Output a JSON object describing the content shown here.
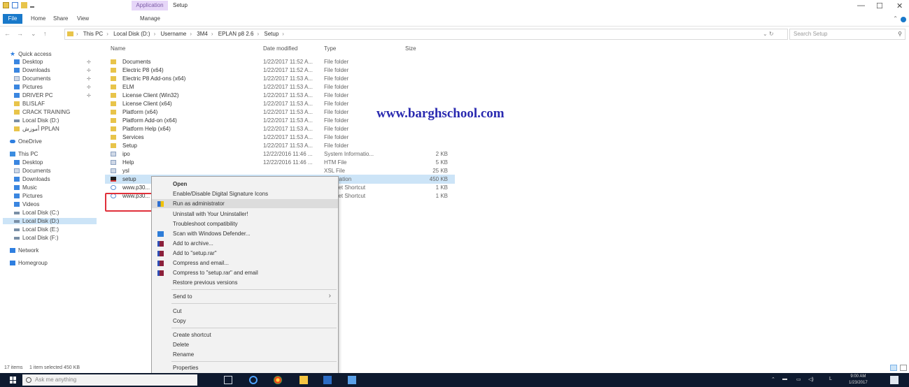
{
  "window": {
    "context_tab": "Application Tools",
    "title": "Setup",
    "controls": [
      "—",
      "☐",
      "✕"
    ]
  },
  "ribbon": {
    "tabs": [
      "File",
      "Home",
      "Share",
      "View",
      "Manage"
    ]
  },
  "address": {
    "path": [
      "This PC",
      "Local Disk (D:)",
      "Username",
      "3M4",
      "EPLAN p8 2.6",
      "Setup"
    ],
    "search_placeholder": "Search Setup"
  },
  "nav": {
    "quick_access": "Quick access",
    "items": [
      {
        "label": "Desktop",
        "pinned": true
      },
      {
        "label": "Downloads",
        "pinned": true
      },
      {
        "label": "Documents",
        "pinned": true
      },
      {
        "label": "Pictures",
        "pinned": true
      },
      {
        "label": "DRIVER PC",
        "pinned": true
      },
      {
        "label": "BLISLAF",
        "pinned": false
      },
      {
        "label": "CRACK TRAINING",
        "pinned": false
      },
      {
        "label": "Local Disk (D:)",
        "pinned": false
      },
      {
        "label": "أموزش PPLAN",
        "pinned": false
      }
    ],
    "onedrive": "OneDrive",
    "this_pc": "This PC",
    "pc_items": [
      "Desktop",
      "Documents",
      "Downloads",
      "Music",
      "Pictures",
      "Videos",
      "Local Disk (C:)",
      "Local Disk (D:)",
      "Local Disk (E:)",
      "Local Disk (F:)"
    ],
    "network": "Network",
    "homegroup": "Homegroup"
  },
  "columns": [
    "Name",
    "Date modified",
    "Type",
    "Size"
  ],
  "files": [
    {
      "name": "Documents",
      "date": "1/22/2017 11:52 A...",
      "type": "File folder",
      "size": "",
      "kind": "folder"
    },
    {
      "name": "Electric P8 (x64)",
      "date": "1/22/2017 11:52 A...",
      "type": "File folder",
      "size": "",
      "kind": "folder"
    },
    {
      "name": "Electric P8 Add-ons (x64)",
      "date": "1/22/2017 11:53 A...",
      "type": "File folder",
      "size": "",
      "kind": "folder"
    },
    {
      "name": "ELM",
      "date": "1/22/2017 11:53 A...",
      "type": "File folder",
      "size": "",
      "kind": "folder"
    },
    {
      "name": "License Client (Win32)",
      "date": "1/22/2017 11:53 A...",
      "type": "File folder",
      "size": "",
      "kind": "folder"
    },
    {
      "name": "License Client (x64)",
      "date": "1/22/2017 11:53 A...",
      "type": "File folder",
      "size": "",
      "kind": "folder"
    },
    {
      "name": "Platform (x64)",
      "date": "1/22/2017 11:53 A...",
      "type": "File folder",
      "size": "",
      "kind": "folder"
    },
    {
      "name": "Platform Add-on (x64)",
      "date": "1/22/2017 11:53 A...",
      "type": "File folder",
      "size": "",
      "kind": "folder"
    },
    {
      "name": "Platform Help (x64)",
      "date": "1/22/2017 11:53 A...",
      "type": "File folder",
      "size": "",
      "kind": "folder"
    },
    {
      "name": "Services",
      "date": "1/22/2017 11:53 A...",
      "type": "File folder",
      "size": "",
      "kind": "folder"
    },
    {
      "name": "Setup",
      "date": "1/22/2017 11:53 A...",
      "type": "File folder",
      "size": "",
      "kind": "folder"
    },
    {
      "name": "ipo",
      "date": "12/22/2016 11:46 ...",
      "type": "System Informatio...",
      "size": "2 KB",
      "kind": "file"
    },
    {
      "name": "Help",
      "date": "12/22/2016 11:46 ...",
      "type": "HTM File",
      "size": "5 KB",
      "kind": "file"
    },
    {
      "name": "ysl",
      "date": "",
      "type": "XSL File",
      "size": "25 KB",
      "kind": "file"
    },
    {
      "name": "setup",
      "date": "",
      "type": "Application",
      "size": "450 KB",
      "kind": "exe",
      "selected": true
    },
    {
      "name": "www.p30...",
      "date": "",
      "type": "Internet Shortcut",
      "size": "1 KB",
      "kind": "web"
    },
    {
      "name": "www.p30...",
      "date": "",
      "type": "Internet Shortcut",
      "size": "1 KB",
      "kind": "web"
    }
  ],
  "watermark": "www.barghschool.com",
  "context_menu": {
    "items": [
      {
        "label": "Open",
        "bold": true
      },
      {
        "label": "Enable/Disable Digital Signature Icons"
      },
      {
        "label": "Run as administrator",
        "icon": "shield",
        "highlight": true
      },
      {
        "label": "Uninstall with Your Uninstaller!"
      },
      {
        "label": "Troubleshoot compatibility"
      },
      {
        "label": "Scan with Windows Defender...",
        "icon": "defender"
      },
      {
        "label": "Add to archive...",
        "icon": "rar"
      },
      {
        "label": "Add to \"setup.rar\"",
        "icon": "rar"
      },
      {
        "label": "Compress and email...",
        "icon": "rar"
      },
      {
        "label": "Compress to \"setup.rar\" and email",
        "icon": "rar"
      },
      {
        "label": "Restore previous versions"
      },
      {
        "label": "Send to",
        "submenu": true
      },
      {
        "label": "Cut"
      },
      {
        "label": "Copy"
      },
      {
        "label": "Create shortcut"
      },
      {
        "label": "Delete"
      },
      {
        "label": "Rename"
      },
      {
        "label": "Properties"
      }
    ]
  },
  "status": {
    "items": "17 items",
    "selected": "1 item selected 450 KB"
  },
  "taskbar": {
    "search_placeholder": "Ask me anything",
    "time": "9:00 AM",
    "date": "1/23/2017"
  }
}
